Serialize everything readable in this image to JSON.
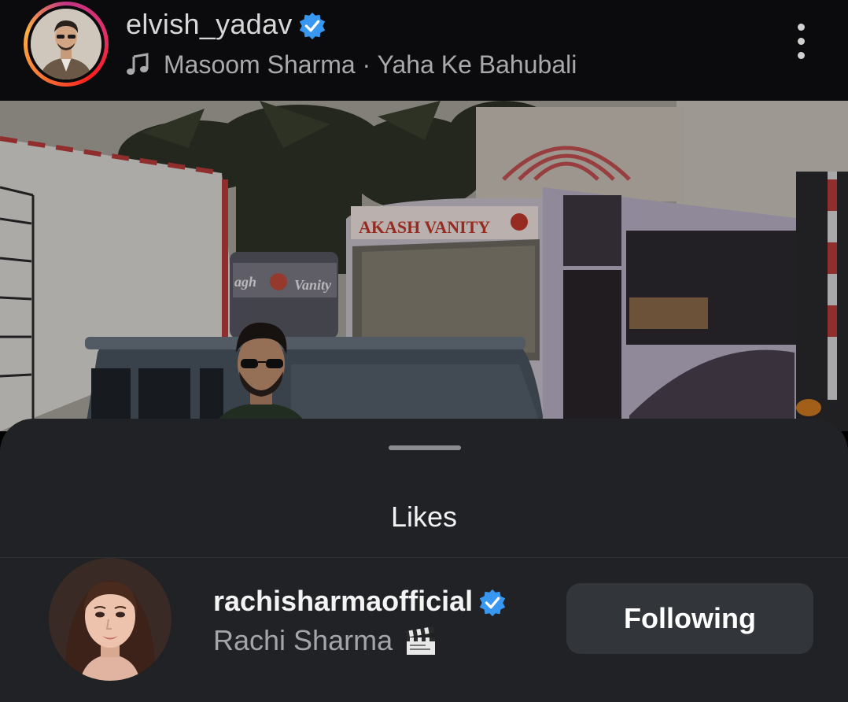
{
  "post_header": {
    "username": "elvish_yadav",
    "verified_icon": "verified-badge-icon",
    "music_icon": "music-note-icon",
    "audio": "Masoom Sharma · Yaha Ke Bahubali",
    "more_icon": "more-vertical-icon",
    "story_ring_colors": [
      "#c13584",
      "#e1306c",
      "#fd1d1d",
      "#f77737",
      "#fcaf45"
    ]
  },
  "photo": {
    "bus_banner_text": "AKASH VANITY",
    "van_text_left": "agh",
    "van_text_right": "Vanity"
  },
  "likes_sheet": {
    "title": "Likes",
    "items": [
      {
        "username": "rachisharmaofficial",
        "verified": true,
        "display_name": "Rachi Sharma",
        "name_emoji_icon": "clapper-board-icon",
        "button_label": "Following"
      }
    ]
  },
  "colors": {
    "verified_blue": "#3897f0",
    "sheet_bg": "#202226",
    "button_bg": "#32353a"
  }
}
